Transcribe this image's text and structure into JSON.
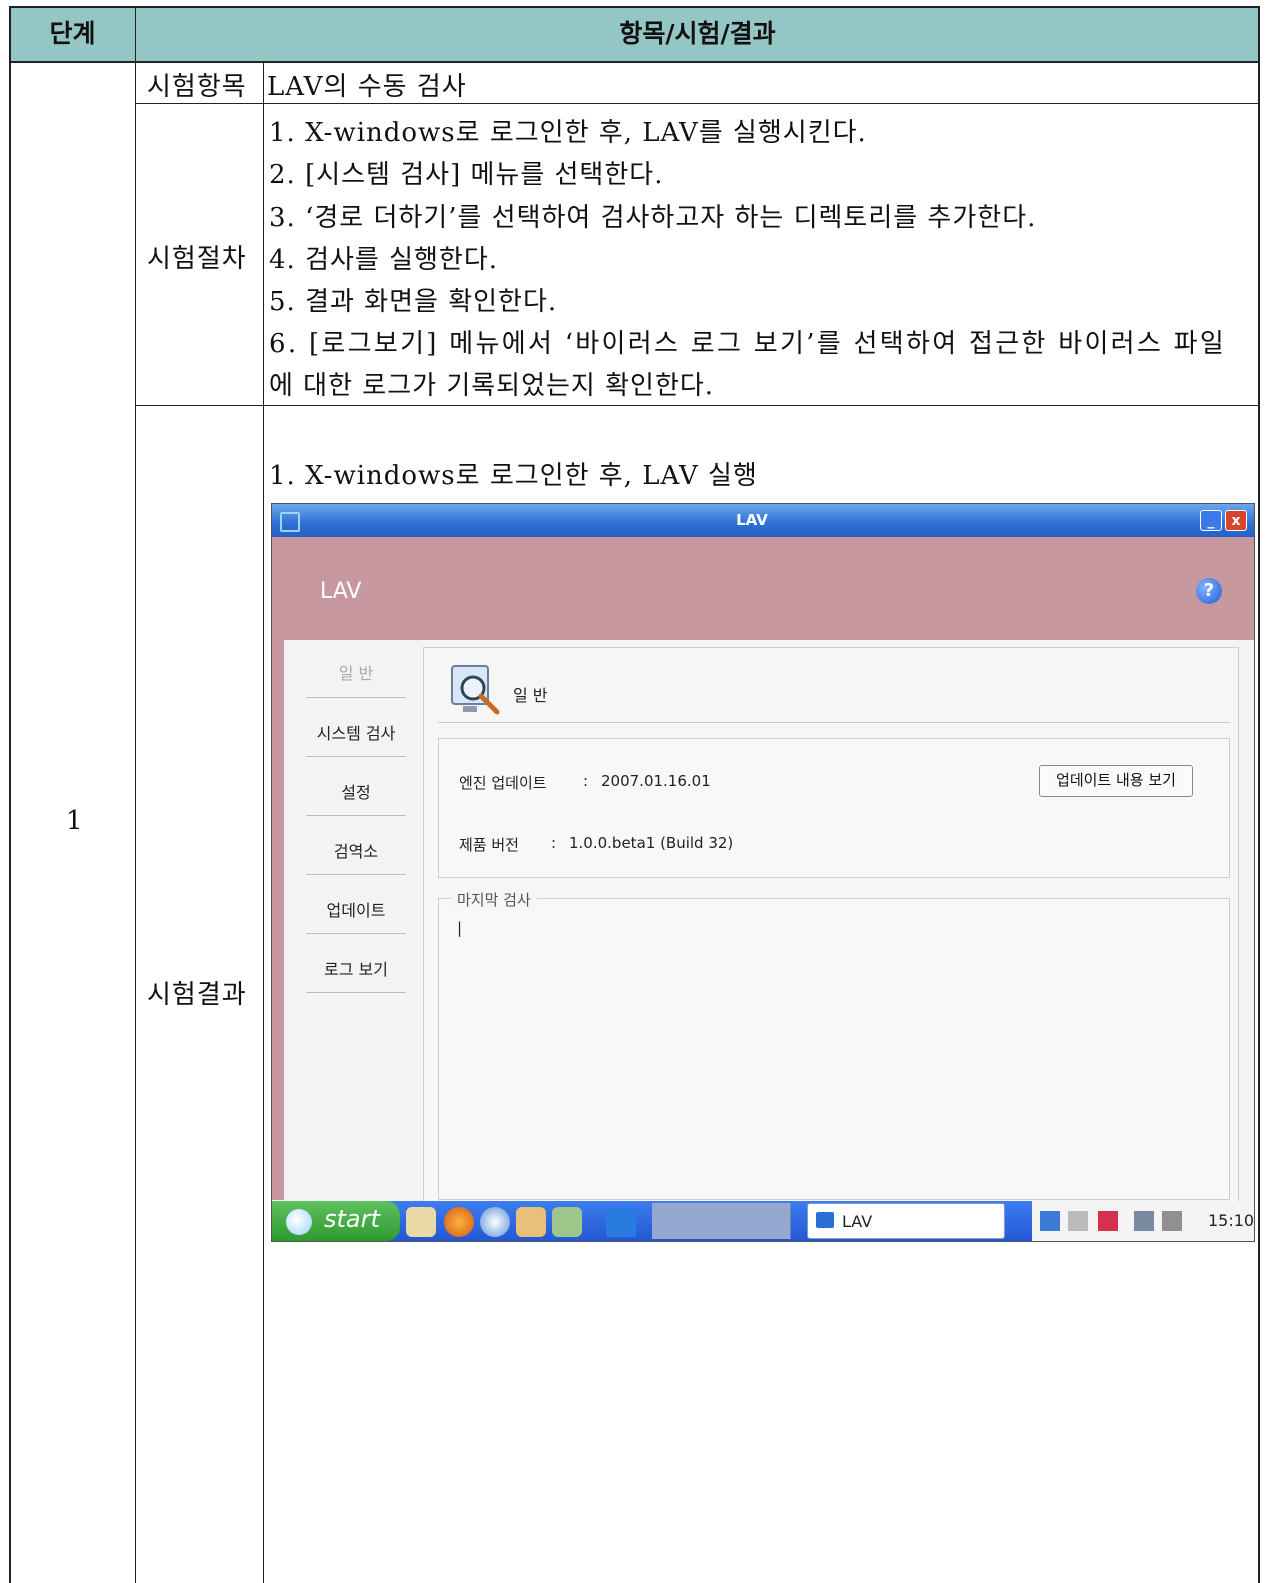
{
  "header": {
    "col_stage": "단계",
    "col_items": "항목/시험/결과"
  },
  "row": {
    "stage": "1",
    "test_item_label": "시험항목",
    "test_item_value": "LAV의 수동 검사",
    "procedure_label": "시험절차",
    "procedure_lines": [
      "1. X-windows로 로그인한 후, LAV를 실행시킨다.",
      "2. [시스템 검사] 메뉴를 선택한다.",
      "3. ‘경로 더하기’를 선택하여 검사하고자 하는 디렉토리를 추가한다.",
      "4. 검사를 실행한다.",
      "5. 결과 화면을 확인한다.",
      "6. [로그보기] 메뉴에서 ‘바이러스 로그 보기’를 선택하여 접근한 바이러스 파일",
      "에 대한 로그가 기록되었는지 확인한다."
    ],
    "result_label": "시험결과",
    "result_caption": "1. X-windows로 로그인한 후, LAV 실행"
  },
  "screenshot": {
    "window_title": "LAV",
    "minimize": "_",
    "close": "x",
    "banner_title": "LAV",
    "help": "?",
    "nav": [
      "일 반",
      "시스템 검사",
      "설정",
      "검역소",
      "업데이트",
      "로그 보기"
    ],
    "panel_title": "일 반",
    "engine_label": "엔진 업데이트",
    "engine_sep": ":",
    "engine_value": "2007.01.16.01",
    "update_button": "업데이트 내용 보기",
    "product_label": "제품 버전",
    "product_sep": ":",
    "product_value": "1.0.0.beta1 (Build 32)",
    "last_scan_title": "마지막 검사",
    "last_scan_text": "|",
    "taskbar": {
      "start": "start",
      "app": "LAV",
      "clock": "15:10"
    }
  }
}
